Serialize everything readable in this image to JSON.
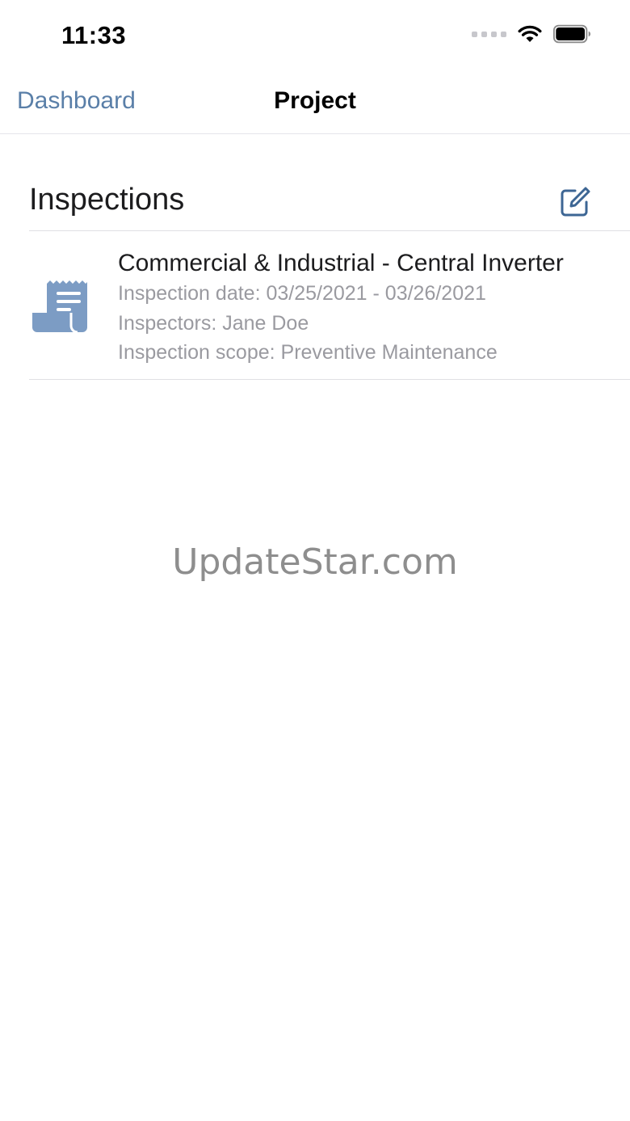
{
  "status_bar": {
    "time": "11:33",
    "icons": [
      "signal-icon",
      "wifi-icon",
      "battery-icon"
    ]
  },
  "nav": {
    "back_label": "Dashboard",
    "title": "Project"
  },
  "inspections": {
    "section_title": "Inspections",
    "edit_icon": "compose-icon",
    "items": [
      {
        "icon": "document-scroll-icon",
        "title": "Commercial & Industrial - Central Inverter",
        "date": "Inspection date: 03/25/2021 - 03/26/2021",
        "inspectors": "Inspectors: Jane Doe",
        "scope": "Inspection scope: Preventive Maintenance"
      }
    ]
  },
  "watermark": "UpdateStar.com",
  "colors": {
    "accent": "#5a7fa8",
    "icon_blue": "#7c9cc4",
    "edit_icon": "#3d6694",
    "secondary_text": "#9a9aa0",
    "separator": "#e0e0e4"
  }
}
